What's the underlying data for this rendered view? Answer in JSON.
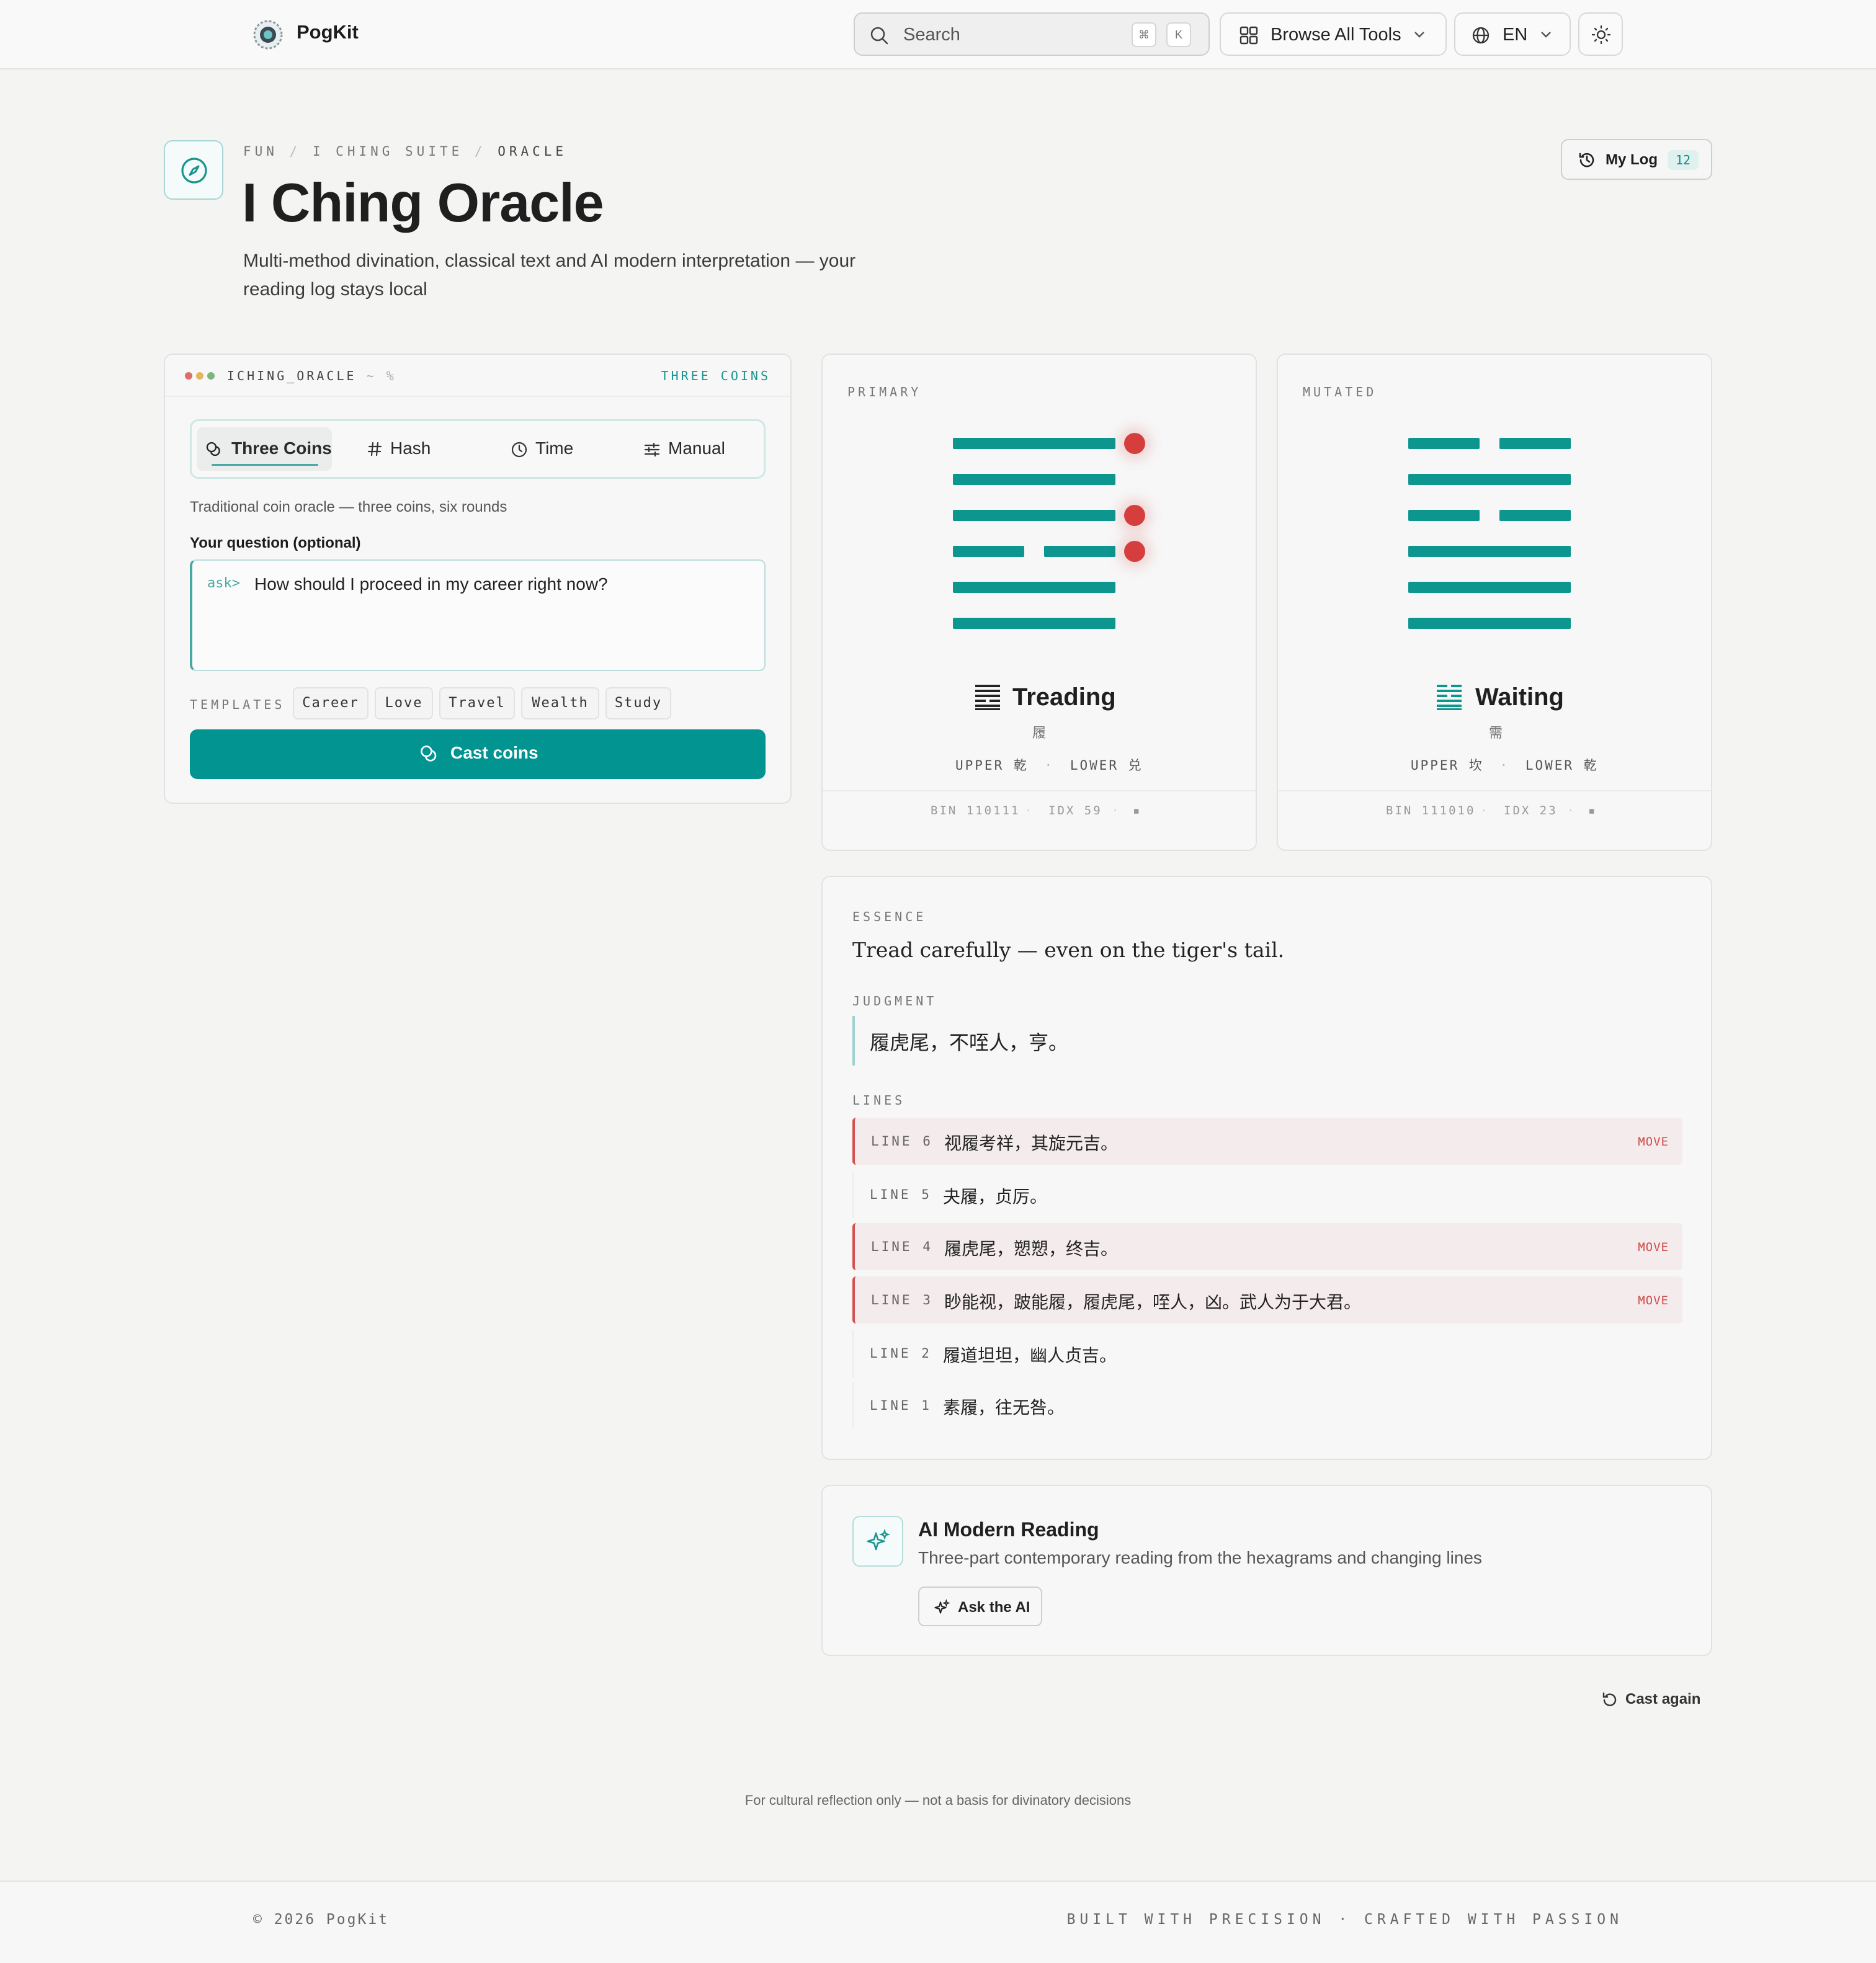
{
  "nav": {
    "brand": "PogKit",
    "search_placeholder": "Search",
    "kbd_cmd": "⌘",
    "kbd_k": "K",
    "browse_label": "Browse All Tools",
    "lang_label": "EN"
  },
  "header": {
    "breadcrumb": [
      "FUN",
      "I CHING SUITE",
      "ORACLE"
    ],
    "title": "I Ching Oracle",
    "subtitle": "Multi-method divination, classical text and AI modern interpretation — your reading log stays local",
    "mylog_label": "My Log",
    "mylog_count": "12"
  },
  "oracle": {
    "window_title": "ICHING_ORACLE",
    "window_suffix": "~ %",
    "mode_label": "THREE COINS",
    "tabs": [
      {
        "label": "Three Coins",
        "active": true
      },
      {
        "label": "Hash",
        "active": false
      },
      {
        "label": "Time",
        "active": false
      },
      {
        "label": "Manual",
        "active": false
      }
    ],
    "method_desc": "Traditional coin oracle — three coins, six rounds",
    "question_label": "Your question (optional)",
    "question_prompt": "ask>",
    "question_value": "How should I proceed in my career right now?",
    "templates_label": "TEMPLATES",
    "templates": [
      "Career",
      "Love",
      "Travel",
      "Wealth",
      "Study"
    ],
    "cast_label": "Cast coins"
  },
  "primary": {
    "tag": "PRIMARY",
    "lines_top_to_bottom": [
      1,
      1,
      1,
      0,
      1,
      1
    ],
    "moving_top_to_bottom": [
      true,
      false,
      true,
      true,
      false,
      false
    ],
    "symbol": "䷉",
    "name": "Treading",
    "chinese": "履",
    "upper": "UPPER 乾",
    "lower": "LOWER 兑",
    "bin": "BIN 110111",
    "idx": "IDX 59",
    "sep": "·",
    "glyph": "▪"
  },
  "mutated": {
    "tag": "MUTATED",
    "lines_top_to_bottom": [
      0,
      1,
      0,
      1,
      1,
      1
    ],
    "symbol": "䷄",
    "name": "Waiting",
    "chinese": "需",
    "upper": "UPPER 坎",
    "lower": "LOWER 乾",
    "bin": "BIN 111010",
    "idx": "IDX 23",
    "sep": "·",
    "glyph": "▪"
  },
  "reading": {
    "essence_label": "ESSENCE",
    "essence": "Tread carefully — even on the tiger's tail.",
    "judgment_label": "JUDGMENT",
    "judgment": "履虎尾，不咥人，亨。",
    "lines_label": "LINES",
    "move_label": "MOVE",
    "lines": [
      {
        "label": "LINE 6",
        "text": "视履考祥，其旋元吉。",
        "moving": true
      },
      {
        "label": "LINE 5",
        "text": "夬履，贞厉。",
        "moving": false
      },
      {
        "label": "LINE 4",
        "text": "履虎尾，愬愬，终吉。",
        "moving": true
      },
      {
        "label": "LINE 3",
        "text": "眇能视，跛能履，履虎尾，咥人，凶。武人为于大君。",
        "moving": true
      },
      {
        "label": "LINE 2",
        "text": "履道坦坦，幽人贞吉。",
        "moving": false
      },
      {
        "label": "LINE 1",
        "text": "素履，往无咎。",
        "moving": false
      }
    ]
  },
  "ai": {
    "title": "AI Modern Reading",
    "subtitle": "Three-part contemporary reading from the hexagrams and changing lines",
    "button": "Ask the AI"
  },
  "cast_again": "Cast again",
  "disclaimer": "For cultural reflection only — not a basis for divinatory decisions",
  "footer": {
    "copyright": "© 2026 PogKit",
    "tagline": "BUILT WITH PRECISION · CRAFTED WITH PASSION"
  },
  "colors": {
    "accent": "#029490",
    "moving_dot": "#d63e3e"
  }
}
